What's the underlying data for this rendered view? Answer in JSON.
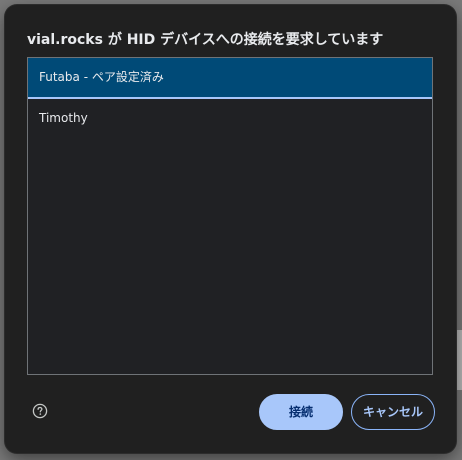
{
  "dialog": {
    "title": "vial.rocks が HID デバイスへの接続を要求しています",
    "devices": [
      {
        "label": "Futaba - ペア設定済み",
        "selected": true
      },
      {
        "label": "Timothy",
        "selected": false
      }
    ],
    "help_icon": "help-circle-icon",
    "connect_label": "接続",
    "cancel_label": "キャンセル"
  },
  "colors": {
    "dialog_bg": "#202020",
    "selected_bg": "#004a77",
    "accent": "#a8c7fa",
    "text": "#e8eaed"
  }
}
